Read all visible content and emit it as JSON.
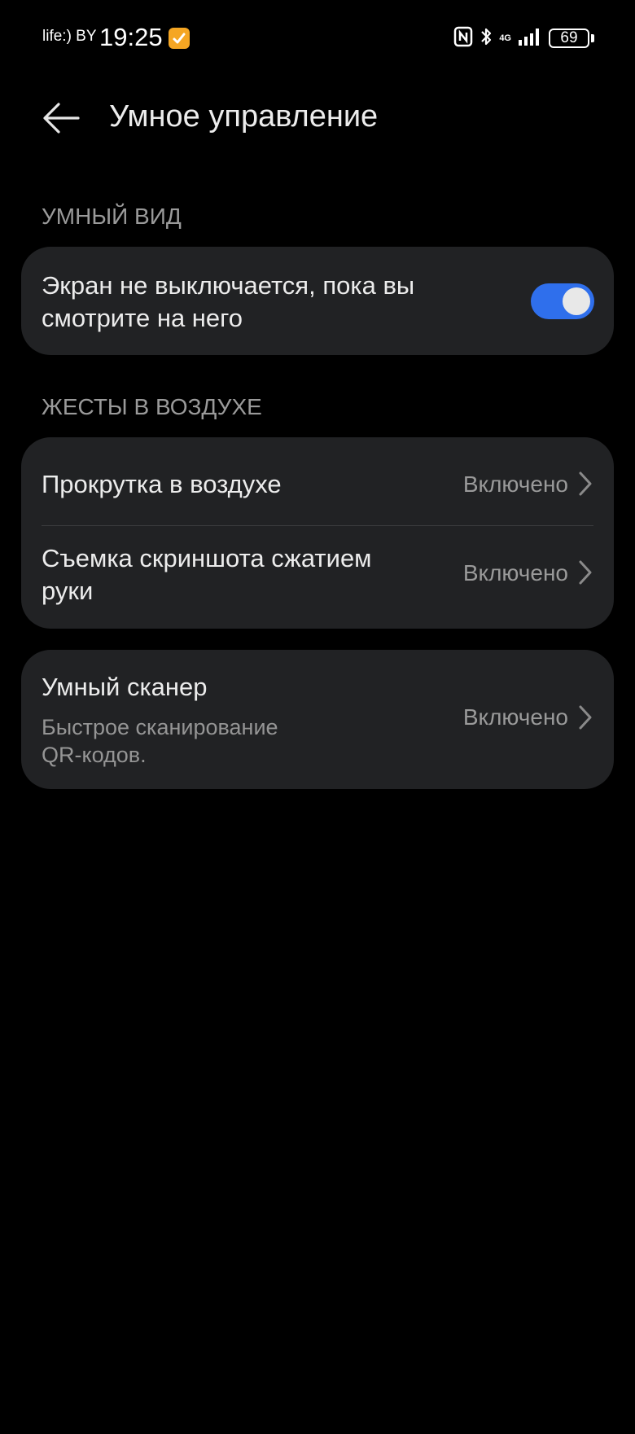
{
  "status_bar": {
    "carrier": "life:) BY",
    "time": "19:25",
    "network": "4G",
    "battery": "69"
  },
  "header": {
    "title": "Умное управление"
  },
  "smart_view": {
    "label": "УМНЫЙ ВИД",
    "item": {
      "title_line1": "Экран не выключается, пока вы",
      "title_line2": "смотрите на него",
      "toggle_on": true
    }
  },
  "air_gestures": {
    "label": "ЖЕСТЫ В ВОЗДУХЕ",
    "items": [
      {
        "title_line1": "Прокрутка в воздухе",
        "value": "Включено"
      },
      {
        "title_line1": "Съемка скриншота сжатием",
        "title_line2": "руки",
        "value": "Включено"
      }
    ]
  },
  "smart_scanner": {
    "title": "Умный сканер",
    "subtitle_line1": "Быстрое сканирование",
    "subtitle_line2": "QR-кодов.",
    "value": "Включено"
  },
  "colors": {
    "background": "#000000",
    "card": "#212224",
    "accent": "#2f6fec",
    "secondary_text": "#9a9a9a"
  },
  "icons": [
    "back-arrow-icon",
    "nfc-icon",
    "bluetooth-icon",
    "signal-icon",
    "battery-icon",
    "chevron-right-icon"
  ]
}
